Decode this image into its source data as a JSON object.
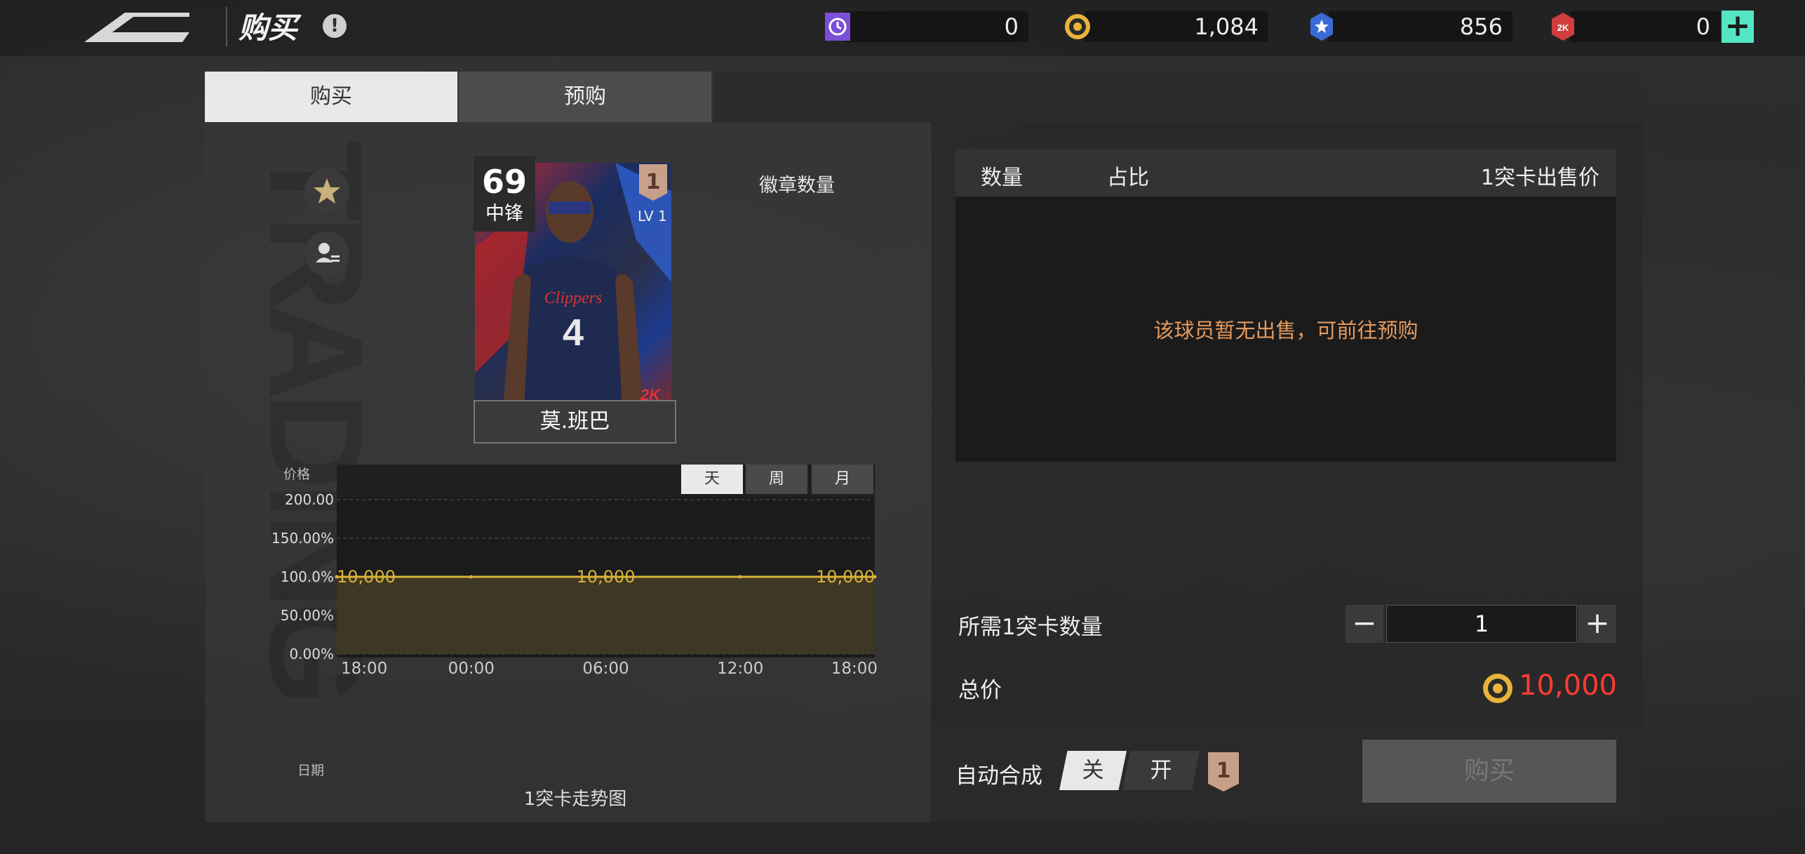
{
  "header": {
    "title": "购买",
    "currencies": [
      {
        "icon": "ticket-icon",
        "value": "0",
        "color": "#7b4fd6"
      },
      {
        "icon": "coin-icon",
        "value": "1,084",
        "color": "#e8b43a"
      },
      {
        "icon": "blue-token-icon",
        "value": "856",
        "color": "#3a6ad6"
      },
      {
        "icon": "red-token-icon",
        "value": "0",
        "color": "#d13c3c"
      }
    ],
    "plus_label": "+"
  },
  "tabs": [
    {
      "label": "购买",
      "active": true
    },
    {
      "label": "预购",
      "active": false
    }
  ],
  "watermark_text": "TRADING",
  "card": {
    "rating": "69",
    "position": "中锋",
    "level": "1",
    "lv_label": "LV 1",
    "name": "莫.班巴",
    "jersey": "4",
    "team": "Clippers",
    "brand": "2K"
  },
  "badge_label": "徽章数量",
  "chart_data": {
    "type": "line",
    "title": "1突卡走势图",
    "ylabel": "价格",
    "xlabel": "日期",
    "ytick_labels": [
      "200.00",
      "150.00%",
      "100.0%",
      "50.00%",
      "0.00%"
    ],
    "x": [
      "18:00",
      "00:00",
      "06:00",
      "12:00",
      "18:00"
    ],
    "series": [
      {
        "name": "",
        "values": [
          100,
          100,
          100,
          100,
          100
        ]
      }
    ],
    "data_labels": [
      "10,000",
      "10,000",
      "10,000"
    ],
    "ylim": [
      0,
      200
    ],
    "grid": true,
    "period_tabs": [
      "天",
      "周",
      "月"
    ],
    "active_period": "天",
    "line_color": "#d9b23a",
    "fill_color": "#3d3723"
  },
  "table": {
    "columns": [
      "数量",
      "占比",
      "1突卡出售价"
    ],
    "empty_message": "该球员暂无出售，可前往预购"
  },
  "quantity": {
    "label": "所需1突卡数量",
    "minus": "−",
    "plus": "+",
    "value": "1"
  },
  "total": {
    "label": "总价",
    "value": "10,000"
  },
  "auto_merge": {
    "label": "自动合成",
    "off": "关",
    "on": "开",
    "level": "1"
  },
  "buy_button": "购买"
}
